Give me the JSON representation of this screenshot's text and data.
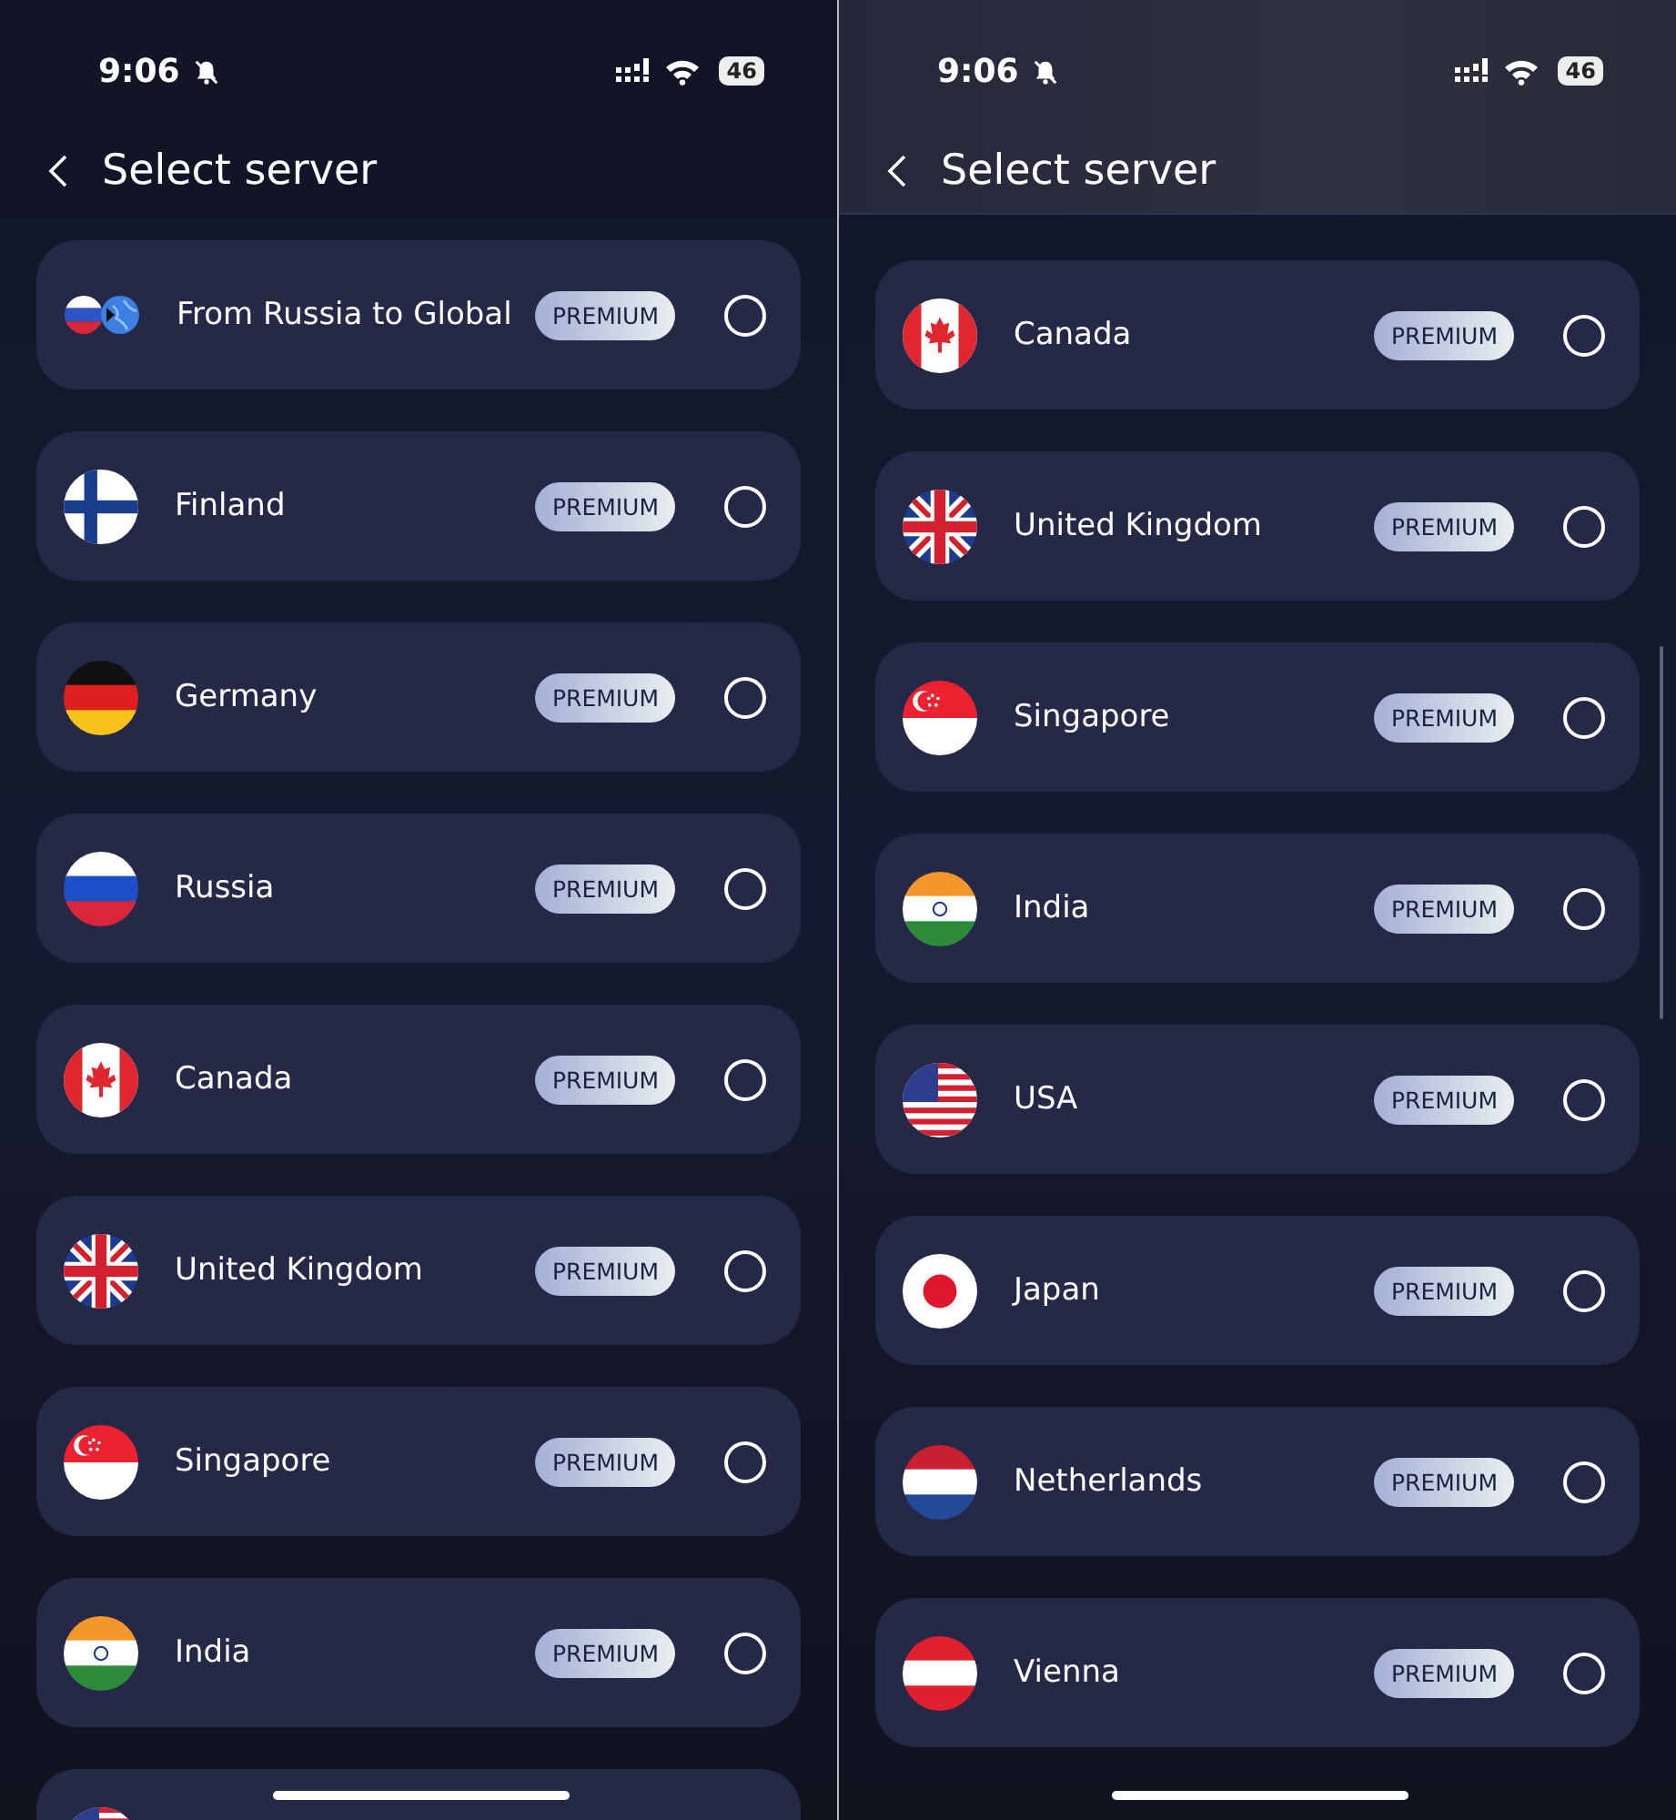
{
  "screens": [
    {
      "status_bar": {
        "time": "9:06",
        "battery": "46"
      },
      "title": "Select server",
      "scrolled": false,
      "servers": [
        {
          "name": "From Russia to Global",
          "kind": "ru-global",
          "badge": "PREMIUM",
          "selected": false
        },
        {
          "name": "Finland",
          "kind": "fi",
          "badge": "PREMIUM",
          "selected": false
        },
        {
          "name": "Germany",
          "kind": "de",
          "badge": "PREMIUM",
          "selected": false
        },
        {
          "name": "Russia",
          "kind": "ru",
          "badge": "PREMIUM",
          "selected": false
        },
        {
          "name": "Canada",
          "kind": "ca",
          "badge": "PREMIUM",
          "selected": false
        },
        {
          "name": "United Kingdom",
          "kind": "gb",
          "badge": "PREMIUM",
          "selected": false
        },
        {
          "name": "Singapore",
          "kind": "sg",
          "badge": "PREMIUM",
          "selected": false
        },
        {
          "name": "India",
          "kind": "in",
          "badge": "PREMIUM",
          "selected": false
        },
        {
          "kind": "us"
        }
      ]
    },
    {
      "status_bar": {
        "time": "9:06",
        "battery": "46"
      },
      "title": "Select server",
      "scrolled": true,
      "servers": [
        {
          "name": "Canada",
          "kind": "ca",
          "badge": "PREMIUM",
          "selected": false
        },
        {
          "name": "United Kingdom",
          "kind": "gb",
          "badge": "PREMIUM",
          "selected": false
        },
        {
          "name": "Singapore",
          "kind": "sg",
          "badge": "PREMIUM",
          "selected": false
        },
        {
          "name": "India",
          "kind": "in",
          "badge": "PREMIUM",
          "selected": false
        },
        {
          "name": "USA",
          "kind": "us",
          "badge": "PREMIUM",
          "selected": false
        },
        {
          "name": "Japan",
          "kind": "jp",
          "badge": "PREMIUM",
          "selected": false
        },
        {
          "name": "Netherlands",
          "kind": "nl",
          "badge": "PREMIUM",
          "selected": false
        },
        {
          "name": "Vienna",
          "kind": "at",
          "badge": "PREMIUM",
          "selected": false
        }
      ]
    }
  ]
}
